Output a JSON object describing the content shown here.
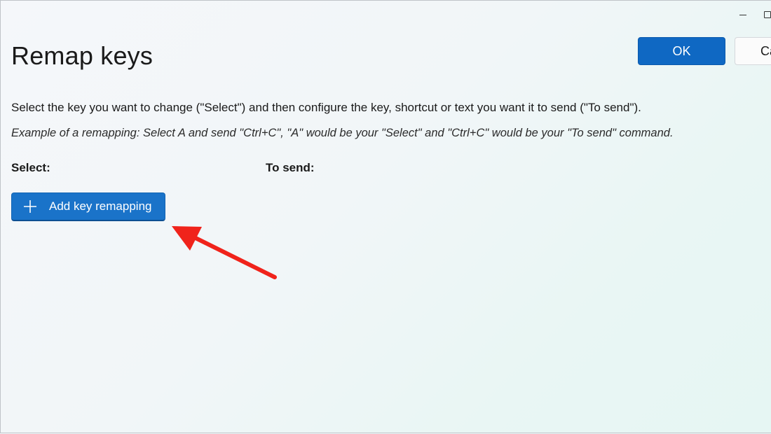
{
  "header": {
    "title": "Remap keys",
    "ok_label": "OK",
    "cancel_label": "Cancel"
  },
  "content": {
    "instructions": "Select the key you want to change (\"Select\") and then configure the key, shortcut or text you want it to send (\"To send\").",
    "example": "Example of a remapping: Select A and send \"Ctrl+C\", \"A\" would be your \"Select\" and \"Ctrl+C\" would be your \"To send\" command.",
    "column_select": "Select:",
    "column_to_send": "To send:",
    "add_button_label": "Add key remapping"
  },
  "icons": {
    "add": "plus-icon",
    "minimize": "minimize-icon",
    "maximize": "maximize-icon",
    "annotation": "red-arrow-annotation"
  },
  "colors": {
    "accent": "#0f68c3",
    "add_button": "#1a73c9",
    "annotation_arrow": "#f0231b"
  }
}
